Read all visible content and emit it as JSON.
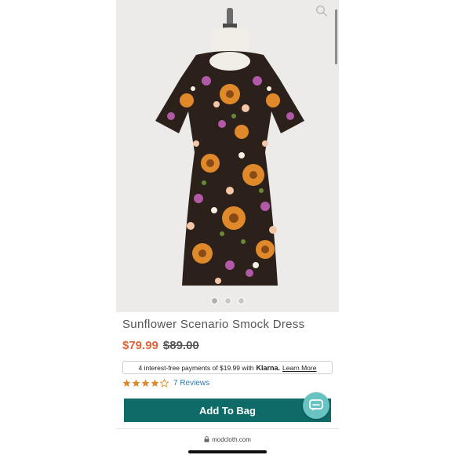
{
  "product": {
    "title": "Sunflower Scenario Smock Dress",
    "sale_price": "$79.99",
    "original_price": "$89.00"
  },
  "klarna": {
    "text": "4 interest-free payments of $19.99 with",
    "brand": "Klarna.",
    "link": "Learn More"
  },
  "rating": {
    "stars": 4,
    "max": 5,
    "reviews": "7 Reviews"
  },
  "actions": {
    "add_to_bag": "Add To Bag"
  },
  "carousel": {
    "count": 3,
    "active": 0
  },
  "browser": {
    "url": "modcloth.com"
  },
  "colors": {
    "sale": "#e0643a",
    "button": "#0f6b68",
    "chat": "#69c3c0",
    "link": "#2c7cb5"
  }
}
